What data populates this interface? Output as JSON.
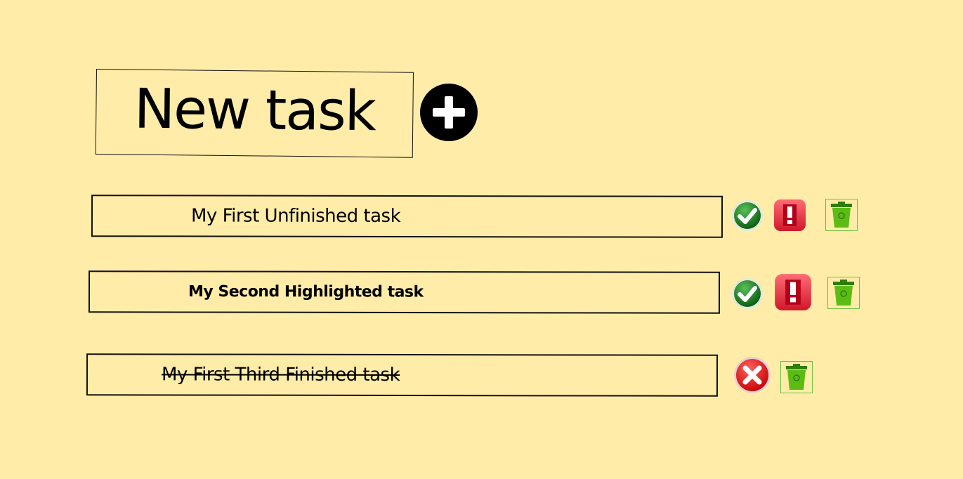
{
  "header": {
    "new_task_label": "New task",
    "add_icon": "plus-circle-icon"
  },
  "tasks": [
    {
      "label": "My First Unfinished task",
      "state": "unfinished",
      "actions": [
        "check-icon",
        "important-icon",
        "trash-icon"
      ]
    },
    {
      "label": "My Second Highlighted task",
      "state": "highlighted",
      "actions": [
        "check-icon",
        "important-icon",
        "trash-icon"
      ]
    },
    {
      "label": "My First Third Finished task",
      "state": "finished",
      "actions": [
        "cancel-icon",
        "trash-icon"
      ]
    }
  ],
  "colors": {
    "background": "#ffeca8",
    "check_green": "#1e7a1e",
    "important_red": "#e0303a",
    "cancel_red": "#e01818",
    "trash_green": "#4cae1a"
  }
}
